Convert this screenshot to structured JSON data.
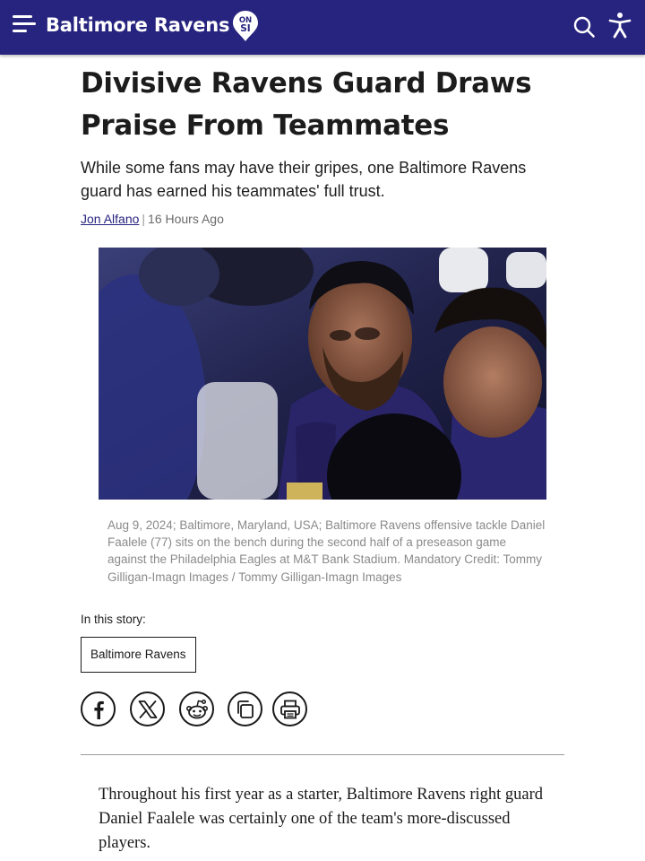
{
  "header": {
    "brand": "Baltimore Ravens",
    "badge_line1": "ON",
    "badge_line2": "SI",
    "icons": [
      "menu-icon",
      "search-icon",
      "accessibility-icon"
    ],
    "background_color": "#27247f"
  },
  "article": {
    "headline": "Divisive Ravens Guard Draws Praise From Teammates",
    "dek": "While some fans may have their gripes, one Baltimore Ravens guard has earned his teammates' full trust.",
    "author": "Jon Alfano",
    "separator": "|",
    "timestamp": "16 Hours Ago",
    "caption": "Aug 9, 2024; Baltimore, Maryland, USA; Baltimore Ravens offensive tackle Daniel Faalele (77) sits on the bench during the second half of a preseason game against the Philadelphia Eagles at M&T Bank Stadium. Mandatory Credit: Tommy Gilligan-Imagn Images / Tommy Gilligan-Imagn Images",
    "in_story_label": "In this story:",
    "story_tags": [
      "Baltimore Ravens"
    ],
    "share_icons": [
      "facebook-icon",
      "x-icon",
      "reddit-icon",
      "copy-link-icon",
      "print-icon"
    ],
    "body_paragraph": "Throughout his first year as a starter, Baltimore Ravens right guard Daniel Faalele was certainly one of the team's more-discussed players."
  }
}
